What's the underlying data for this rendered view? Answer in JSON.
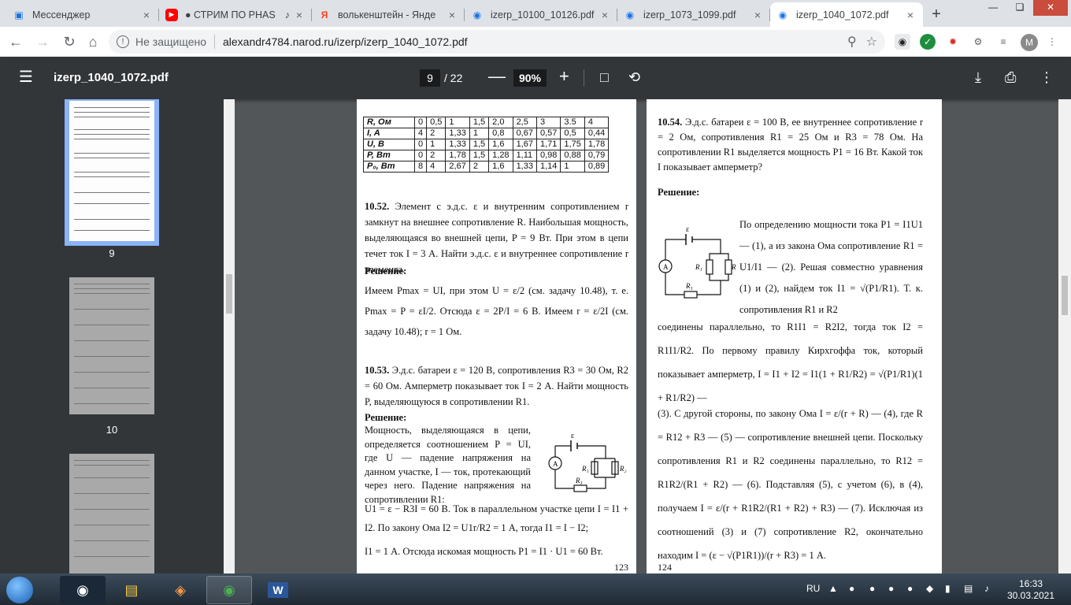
{
  "browser": {
    "tabs": [
      {
        "title": "Мессенджер",
        "icon": "messenger-icon",
        "color": "#1a73e8",
        "active": false,
        "audio": false
      },
      {
        "title": "● СТРИМ ПО PHAS",
        "icon": "youtube-icon",
        "color": "#ff0000",
        "active": false,
        "audio": true
      },
      {
        "title": "волькенштейн - Янде",
        "icon": "yandex-icon",
        "color": "#fc3f1d",
        "active": false,
        "audio": false
      },
      {
        "title": "izerp_10100_10126.pdf",
        "icon": "pdf-icon",
        "color": "#1a73e8",
        "active": false,
        "audio": false
      },
      {
        "title": "izerp_1073_1099.pdf",
        "icon": "pdf-icon",
        "color": "#1a73e8",
        "active": false,
        "audio": false
      },
      {
        "title": "izerp_1040_1072.pdf",
        "icon": "pdf-icon",
        "color": "#1a73e8",
        "active": true,
        "audio": false
      }
    ],
    "security_label": "Не защищено",
    "url": "alexandr4784.narod.ru/izerp/izerp_1040_1072.pdf",
    "profile_initial": "M"
  },
  "viewer": {
    "filename": "izerp_1040_1072.pdf",
    "current_page": "9",
    "total_pages": "/ 22",
    "zoom": "90%"
  },
  "thumbnails": [
    {
      "label": "9",
      "selected": true
    },
    {
      "label": "10",
      "selected": false
    },
    {
      "label": "",
      "selected": false
    }
  ],
  "page_left": {
    "table": {
      "rows": [
        {
          "head": "R, Ом",
          "cells": [
            "0",
            "0,5",
            "1",
            "1,5",
            "2,0",
            "2,5",
            "3",
            "3.5",
            "4"
          ]
        },
        {
          "head": "I, A",
          "cells": [
            "4",
            "2",
            "1,33",
            "1",
            "0,8",
            "0,67",
            "0,57",
            "0,5",
            "0,44"
          ]
        },
        {
          "head": "U, B",
          "cells": [
            "0",
            "1",
            "1,33",
            "1,5",
            "1,6",
            "1,67",
            "1,71",
            "1,75",
            "1,78"
          ]
        },
        {
          "head": "P, Вт",
          "cells": [
            "0",
            "2",
            "1,78",
            "1,5",
            "1,28",
            "1,11",
            "0,98",
            "0,88",
            "0,79"
          ]
        },
        {
          "head": "P₀, Вт",
          "cells": [
            "8",
            "4",
            "2,67",
            "2",
            "1,6",
            "1,33",
            "1,14",
            "1",
            "0,89"
          ]
        }
      ]
    },
    "p1052_num": "10.52.",
    "p1052_text": "Элемент с э.д.с. ε и внутренним сопротивлением r замкнут на внешнее сопротивление R. Наибольшая мощность, выделяющаяся во внешней цепи, P = 9 Вт. При этом в цепи течет ток I = 3 А. Найти э.д.с. ε и внутреннее сопротивление r элемента.",
    "solution_label": "Решение:",
    "p1052_sol": "Имеем Pmax = UI, при этом U = ε/2 (см. задачу 10.48), т. е. Pmax = P = εI/2. Отсюда ε = 2P/I = 6 В. Имеем r = ε/2I (см. задачу 10.48); r = 1 Ом.",
    "p1053_num": "10.53.",
    "p1053_text": "Э.д.с. батареи ε = 120 В, сопротивления R3 = 30 Ом, R2 = 60 Ом. Амперметр показывает ток I = 2 А. Найти мощность P, выделяющуюся в сопротивлении R1.",
    "solution_label2": "Решение:",
    "p1053_sol_a": "Мощность, выделяющаяся в цепи, определяется соотношением P = UI, где U — падение напряжения на данном участке, I — ток, протекающий через него. Падение напряжения на сопротивлении R1:",
    "p1053_sol_b": "U1 = ε − R3I = 60 В. Ток в параллельном участке цепи I = I1 + I2. По закону Ома I2 = U1r/R2 = 1 А, тогда I1 = I − I2;",
    "p1053_sol_c": "I1 = 1 А. Отсюда искомая мощность P1 = I1 · U1 = 60 Вт.",
    "page_number": "123"
  },
  "page_right": {
    "p1054_num": "10.54.",
    "p1054_text": "Э.д.с. батареи ε = 100 В, ее внутреннее сопротивление r = 2 Ом, сопротивления R1 = 25 Ом и R3 = 78 Ом. На сопротивлении R1 выделяется мощность P1 = 16 Вт. Какой ток I показывает амперметр?",
    "solution_label": "Решение:",
    "sol_a": "По определению мощности тока P1 = I1U1 — (1), а из закона Ома сопротивление R1 = U1/I1 — (2). Решая совместно уравнения (1) и (2), найдем ток I1 = √(P1/R1). Т. к. сопротивления R1 и R2",
    "sol_b": "соединены параллельно, то R1I1 = R2I2, тогда ток I2 = R1I1/R2. По первому правилу Кирхгоффа ток, который показывает амперметр, I = I1 + I2 = I1(1 + R1/R2) = √(P1/R1)(1 + R1/R2) —",
    "sol_c": "(3). С другой стороны, по закону Ома I = ε/(r + R) — (4), где R = R12 + R3 — (5) — сопротивление внешней цепи. Поскольку сопротивления R1 и R2 соединены параллельно, то R12 = R1R2/(R1 + R2) — (6). Подставляя (5), с учетом (6), в (4), получаем I = ε/(r + R1R2/(R1 + R2) + R3) — (7). Исключая из соотношений (3) и (7) сопротивление R2, окончательно находим I = (ε − √(P1R1))/(r + R3) = 1 А.",
    "page_number": "124"
  },
  "taskbar": {
    "language": "RU",
    "time": "16:33",
    "date": "30.03.2021"
  }
}
